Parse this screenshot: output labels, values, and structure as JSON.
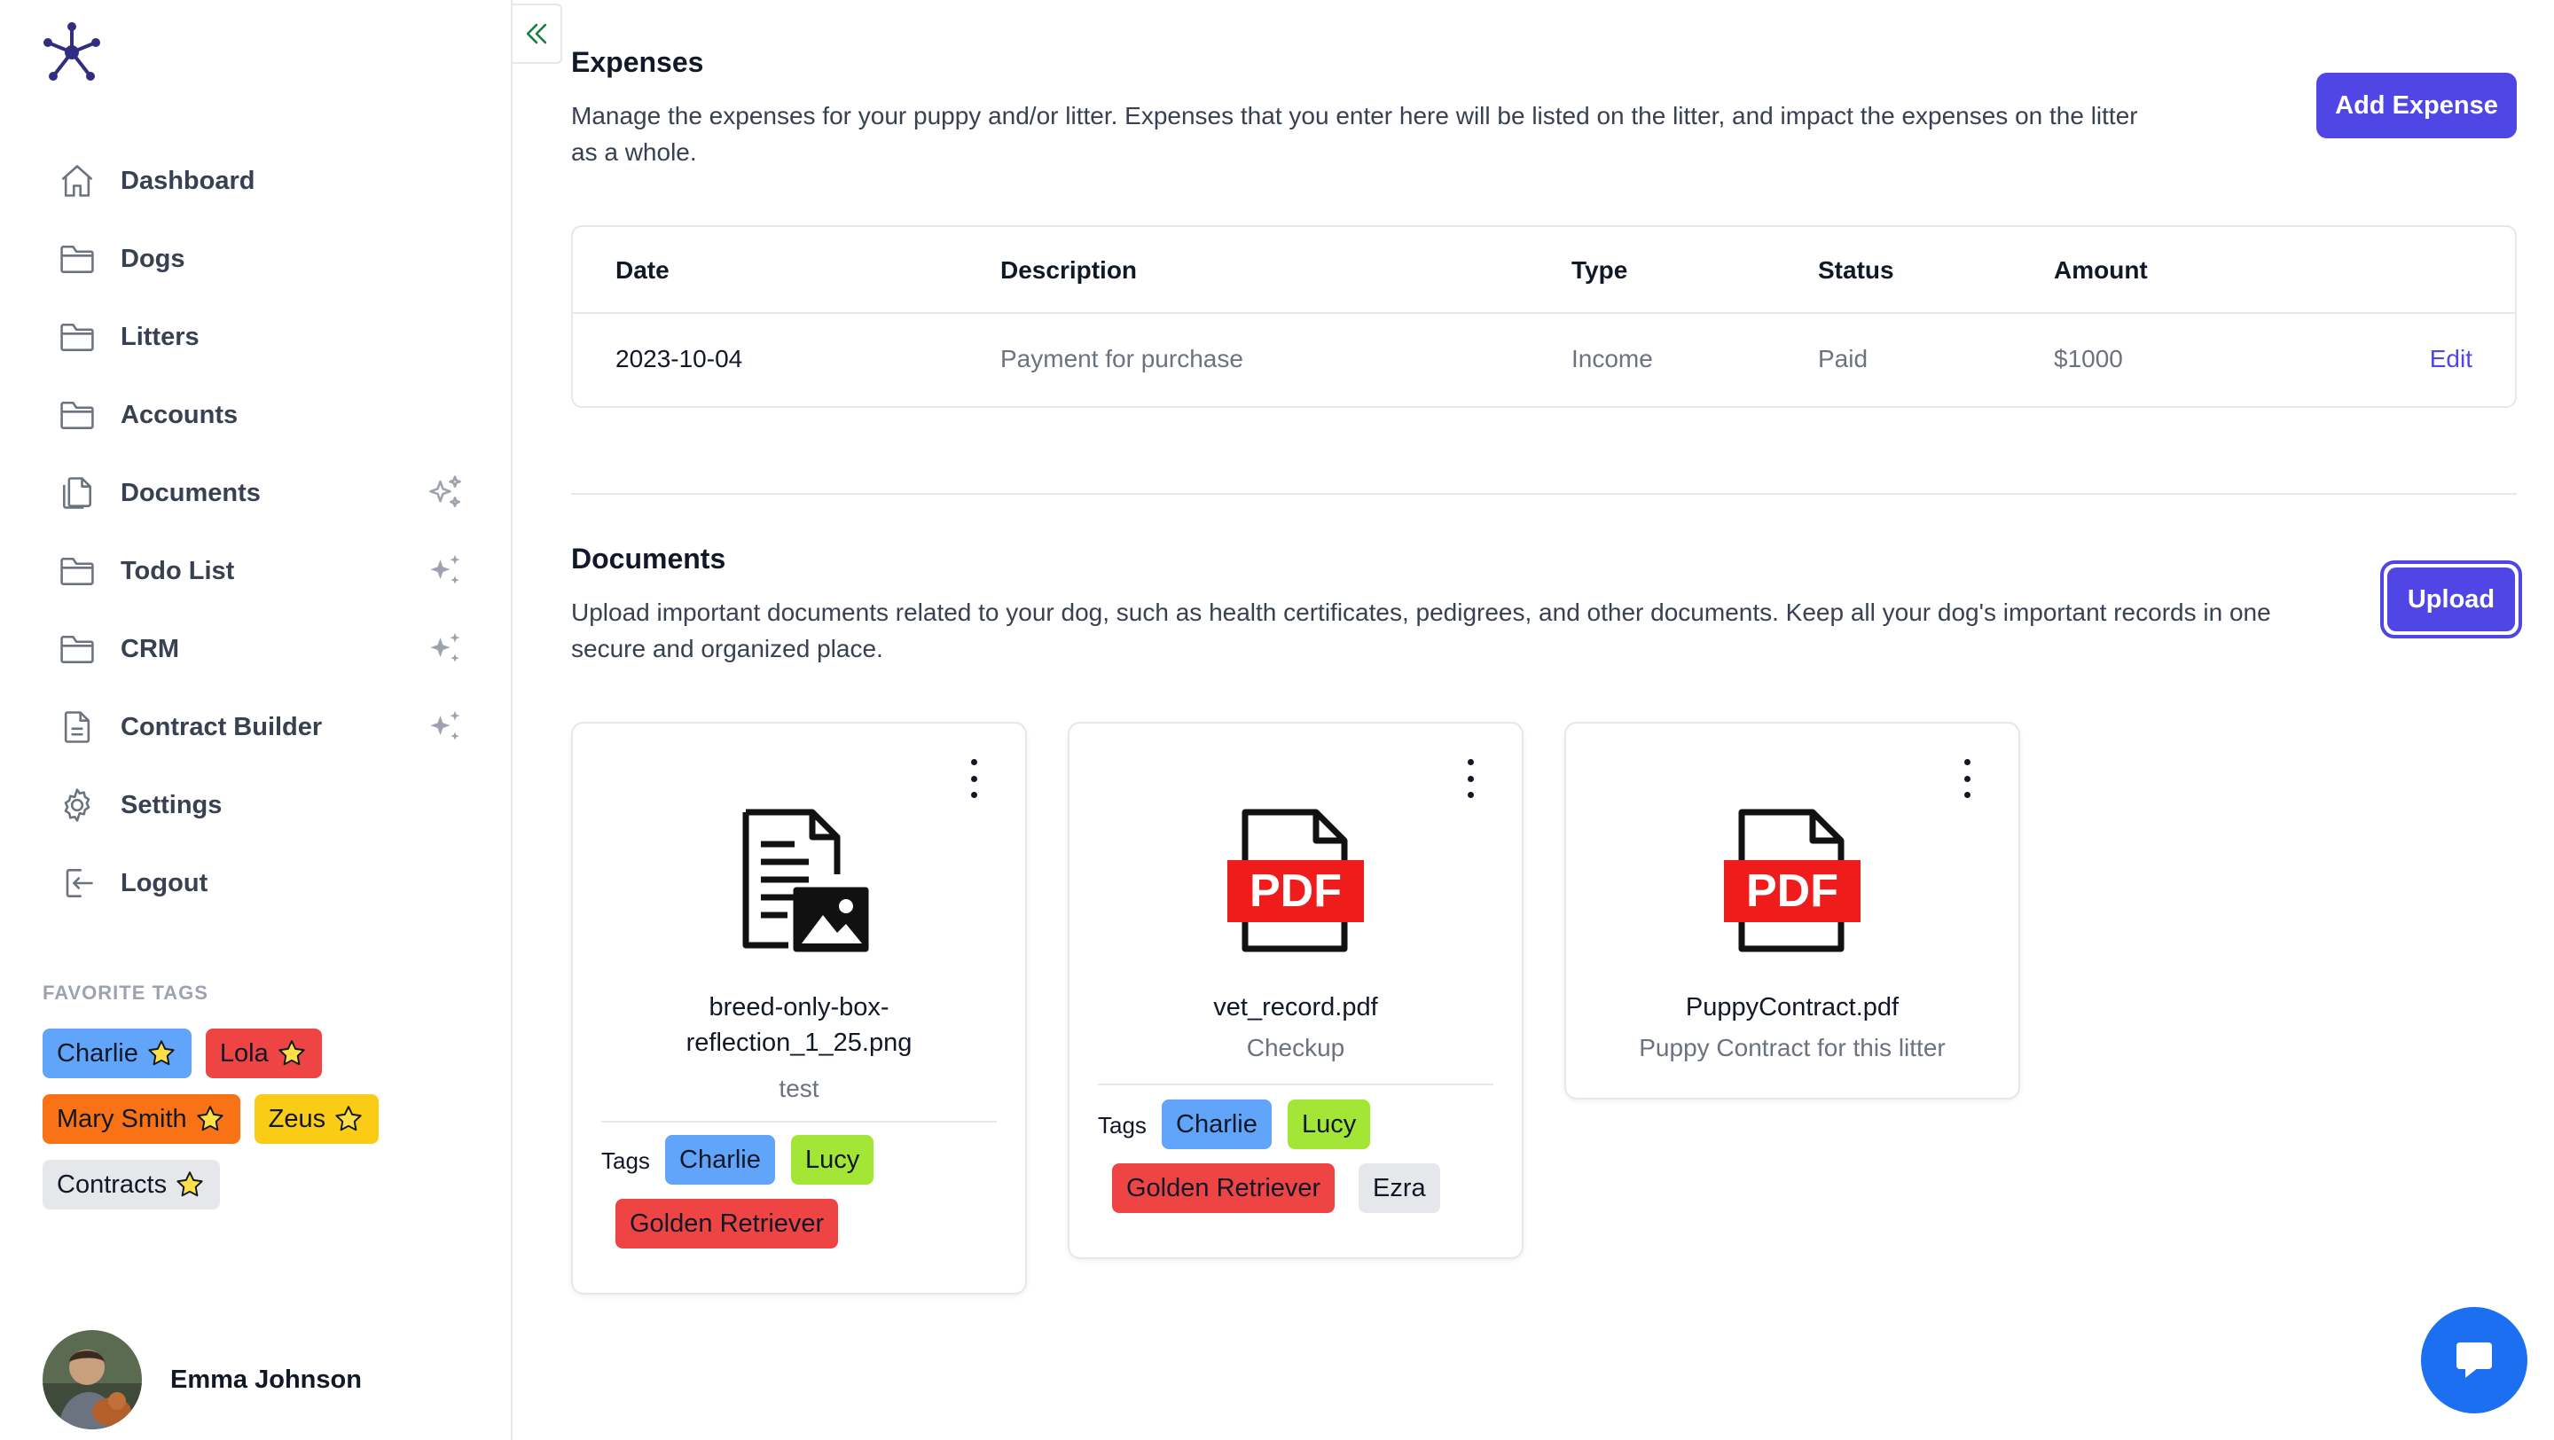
{
  "sidebar": {
    "nav": [
      {
        "label": "Dashboard",
        "icon": "home-icon"
      },
      {
        "label": "Dogs",
        "icon": "folder-icon"
      },
      {
        "label": "Litters",
        "icon": "folder-icon"
      },
      {
        "label": "Accounts",
        "icon": "folder-icon"
      },
      {
        "label": "Documents",
        "icon": "documents-icon"
      },
      {
        "label": "Todo List",
        "icon": "folder-icon"
      },
      {
        "label": "CRM",
        "icon": "folder-icon"
      },
      {
        "label": "Contract Builder",
        "icon": "document-icon"
      },
      {
        "label": "Settings",
        "icon": "gear-icon"
      },
      {
        "label": "Logout",
        "icon": "logout-icon"
      }
    ],
    "favorite_tags_title": "FAVORITE TAGS",
    "favorite_tags": [
      {
        "label": "Charlie",
        "color": "#60a5fa"
      },
      {
        "label": "Lola",
        "color": "#ef4444"
      },
      {
        "label": "Mary Smith",
        "color": "#f97316"
      },
      {
        "label": "Zeus",
        "color": "#facc15"
      },
      {
        "label": "Contracts",
        "color": "#e5e7eb"
      }
    ],
    "user_name": "Emma Johnson"
  },
  "expenses": {
    "title": "Expenses",
    "description": "Manage the expenses for your puppy and/or litter. Expenses that you enter here will be listed on the litter, and impact the expenses on the litter as a whole.",
    "add_button": "Add Expense",
    "columns": [
      "Date",
      "Description",
      "Type",
      "Status",
      "Amount"
    ],
    "rows": [
      {
        "date": "2023-10-04",
        "description": "Payment for purchase",
        "type": "Income",
        "status": "Paid",
        "amount": "$1000",
        "action": "Edit"
      }
    ]
  },
  "documents": {
    "title": "Documents",
    "description": "Upload important documents related to your dog, such as health certificates, pedigrees, and other documents. Keep all your dog's important records in one secure and organized place.",
    "upload_button": "Upload",
    "tags_label": "Tags",
    "cards": [
      {
        "name_line1": "breed-only-box-",
        "name_line2": "reflection_1_25.png",
        "description": "test",
        "icon": "image-file-icon",
        "tags": [
          {
            "label": "Charlie",
            "color": "#60a5fa"
          },
          {
            "label": "Lucy",
            "color": "#a3e635"
          },
          {
            "label": "Golden Retriever",
            "color": "#ef4444"
          }
        ]
      },
      {
        "name": "vet_record.pdf",
        "description": "Checkup",
        "icon": "pdf-file-icon",
        "tags": [
          {
            "label": "Charlie",
            "color": "#60a5fa"
          },
          {
            "label": "Lucy",
            "color": "#a3e635"
          },
          {
            "label": "Golden Retriever",
            "color": "#ef4444"
          },
          {
            "label": "Ezra",
            "color": "#e5e7eb"
          }
        ]
      },
      {
        "name": "PuppyContract.pdf",
        "description": "Puppy Contract for this litter",
        "icon": "pdf-file-icon",
        "tags": []
      }
    ]
  },
  "colors": {
    "accent": "#4f46e5",
    "chat": "#1d6ff2",
    "pdf_red": "#ef1c1c"
  }
}
